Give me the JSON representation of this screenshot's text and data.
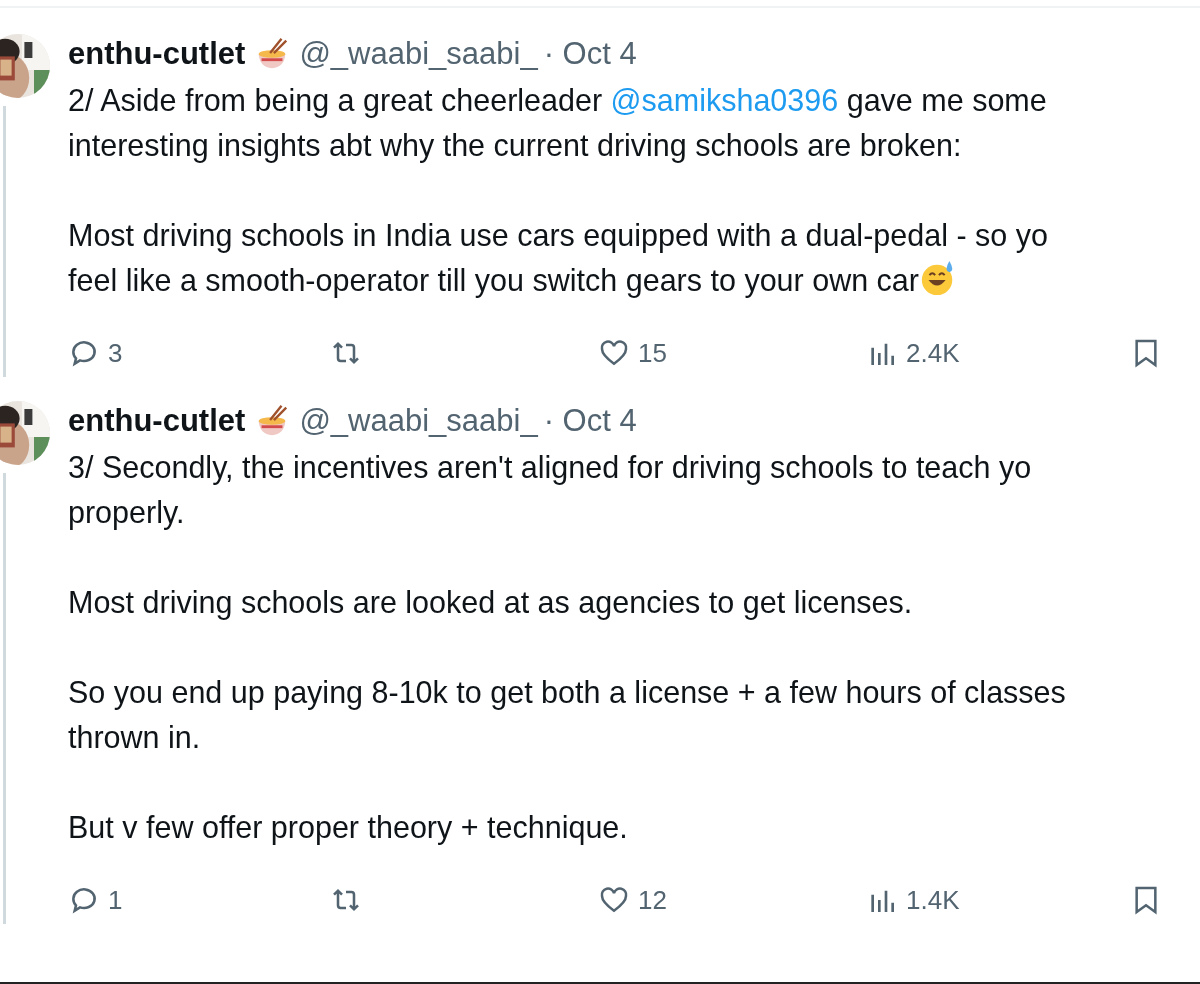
{
  "tweets": [
    {
      "author": {
        "name": "enthu-cutlet",
        "handle": "@_waabi_saabi_",
        "date": "· Oct 4"
      },
      "paragraphs": [
        [
          {
            "kind": "text",
            "text": "2/ Aside from being a great cheerleader "
          },
          {
            "kind": "mention",
            "text": "@samiksha0396"
          },
          {
            "kind": "text",
            "text": " gave me some\ninteresting insights abt why the current driving schools are broken:"
          }
        ],
        [
          {
            "kind": "text",
            "text": "Most driving schools in India use cars equipped with a dual-pedal - so yo\nfeel like a smooth-operator till you switch gears to your own car"
          },
          {
            "kind": "emoji"
          }
        ]
      ],
      "stats": {
        "replies": "3",
        "likes": "15",
        "views": "2.4K"
      }
    },
    {
      "author": {
        "name": "enthu-cutlet",
        "handle": "@_waabi_saabi_",
        "date": "· Oct 4"
      },
      "paragraphs": [
        [
          {
            "kind": "text",
            "text": "3/ Secondly, the incentives aren't aligned for driving schools to teach yo\nproperly."
          }
        ],
        [
          {
            "kind": "text",
            "text": "Most driving schools are looked at as agencies to get licenses."
          }
        ],
        [
          {
            "kind": "text",
            "text": "So you end up paying 8-10k to get both a license + a few hours of classes\nthrown in."
          }
        ],
        [
          {
            "kind": "text",
            "text": "But v few offer proper theory + technique."
          }
        ]
      ],
      "stats": {
        "replies": "1",
        "likes": "12",
        "views": "1.4K"
      }
    }
  ]
}
